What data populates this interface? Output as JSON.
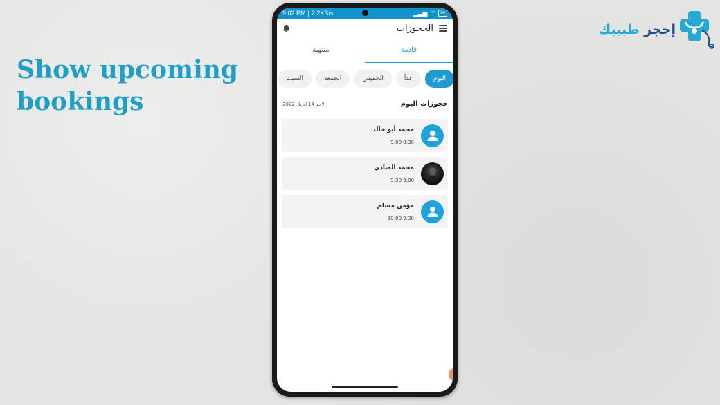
{
  "headline": {
    "line1": "Show upcoming",
    "line2": "bookings"
  },
  "brand": {
    "word1": "إحجز",
    "word2": "طبيبك"
  },
  "statusbar": {
    "time": "9:02 PM",
    "speed": "2.2KB/s",
    "battery": "84"
  },
  "header": {
    "title": "الحجوزات"
  },
  "tabs": [
    {
      "label": "قادمة",
      "active": true
    },
    {
      "label": "منتهية",
      "active": false
    }
  ],
  "days": [
    {
      "label": "اليوم",
      "active": true
    },
    {
      "label": "غداً",
      "active": false
    },
    {
      "label": "الخميس",
      "active": false
    },
    {
      "label": "الجمعة",
      "active": false
    },
    {
      "label": "السبت",
      "active": false
    }
  ],
  "section": {
    "title": "حجوزات اليوم",
    "date": "الاحد 14 ابريل 2022"
  },
  "bookings": [
    {
      "name": "محمد أبو خالد",
      "time": "8:30 9:00",
      "avatar": "user-icon"
    },
    {
      "name": "محمد الصادي",
      "time": "9:00 9:30",
      "avatar": "photo"
    },
    {
      "name": "مؤمن مسلم",
      "time": "9:30 10:00",
      "avatar": "user-icon"
    }
  ],
  "colors": {
    "accent": "#1e9bd1",
    "headline": "#1f9fc8",
    "statusbar": "#0e93cc"
  }
}
